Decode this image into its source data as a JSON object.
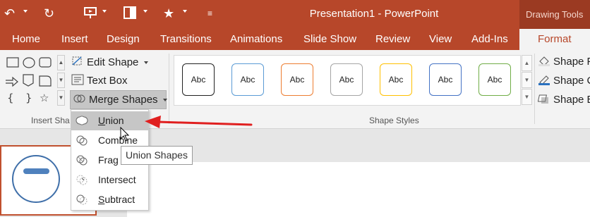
{
  "window": {
    "title": "Presentation1 - PowerPoint",
    "context_label": "Drawing Tools"
  },
  "quick_access": {
    "icons": [
      "undo-icon",
      "redo-icon",
      "slideshow-icon",
      "layout-icon",
      "star-icon",
      "customize-icon"
    ]
  },
  "tabs": [
    "Home",
    "Insert",
    "Design",
    "Transitions",
    "Animations",
    "Slide Show",
    "Review",
    "View",
    "Add-Ins"
  ],
  "active_tab": "Format",
  "insert_shapes": {
    "group_label": "Insert Sha",
    "edit_shape": "Edit Shape",
    "text_box": "Text Box",
    "merge_shapes": "Merge Shapes"
  },
  "shape_styles": {
    "group_label": "Shape Styles",
    "sample_text": "Abc",
    "swatches": [
      {
        "border": "#222222"
      },
      {
        "border": "#5b9bd5"
      },
      {
        "border": "#ed7d31"
      },
      {
        "border": "#a5a5a5"
      },
      {
        "border": "#ffc000"
      },
      {
        "border": "#4472c4"
      },
      {
        "border": "#70ad47"
      }
    ]
  },
  "shape_fill_cmds": [
    "Shape F",
    "Shape C",
    "Shape E"
  ],
  "merge_menu": {
    "items": [
      {
        "label": "Union",
        "hotkey": "U",
        "rest": "nion",
        "highlighted": true
      },
      {
        "label": "Combine",
        "hotkey": "",
        "rest": "Combine",
        "highlighted": false
      },
      {
        "label": "Fragment",
        "hotkey": "",
        "rest": "Frag",
        "highlighted": false
      },
      {
        "label": "Intersect",
        "hotkey": "",
        "rest": "Intersect",
        "highlighted": false
      },
      {
        "label": "Subtract",
        "hotkey": "S",
        "rest": "ubtract",
        "highlighted": false
      }
    ]
  },
  "tooltip": "Union Shapes",
  "colors": {
    "accent": "#b7472a",
    "annotation_arrow": "#e02020"
  }
}
